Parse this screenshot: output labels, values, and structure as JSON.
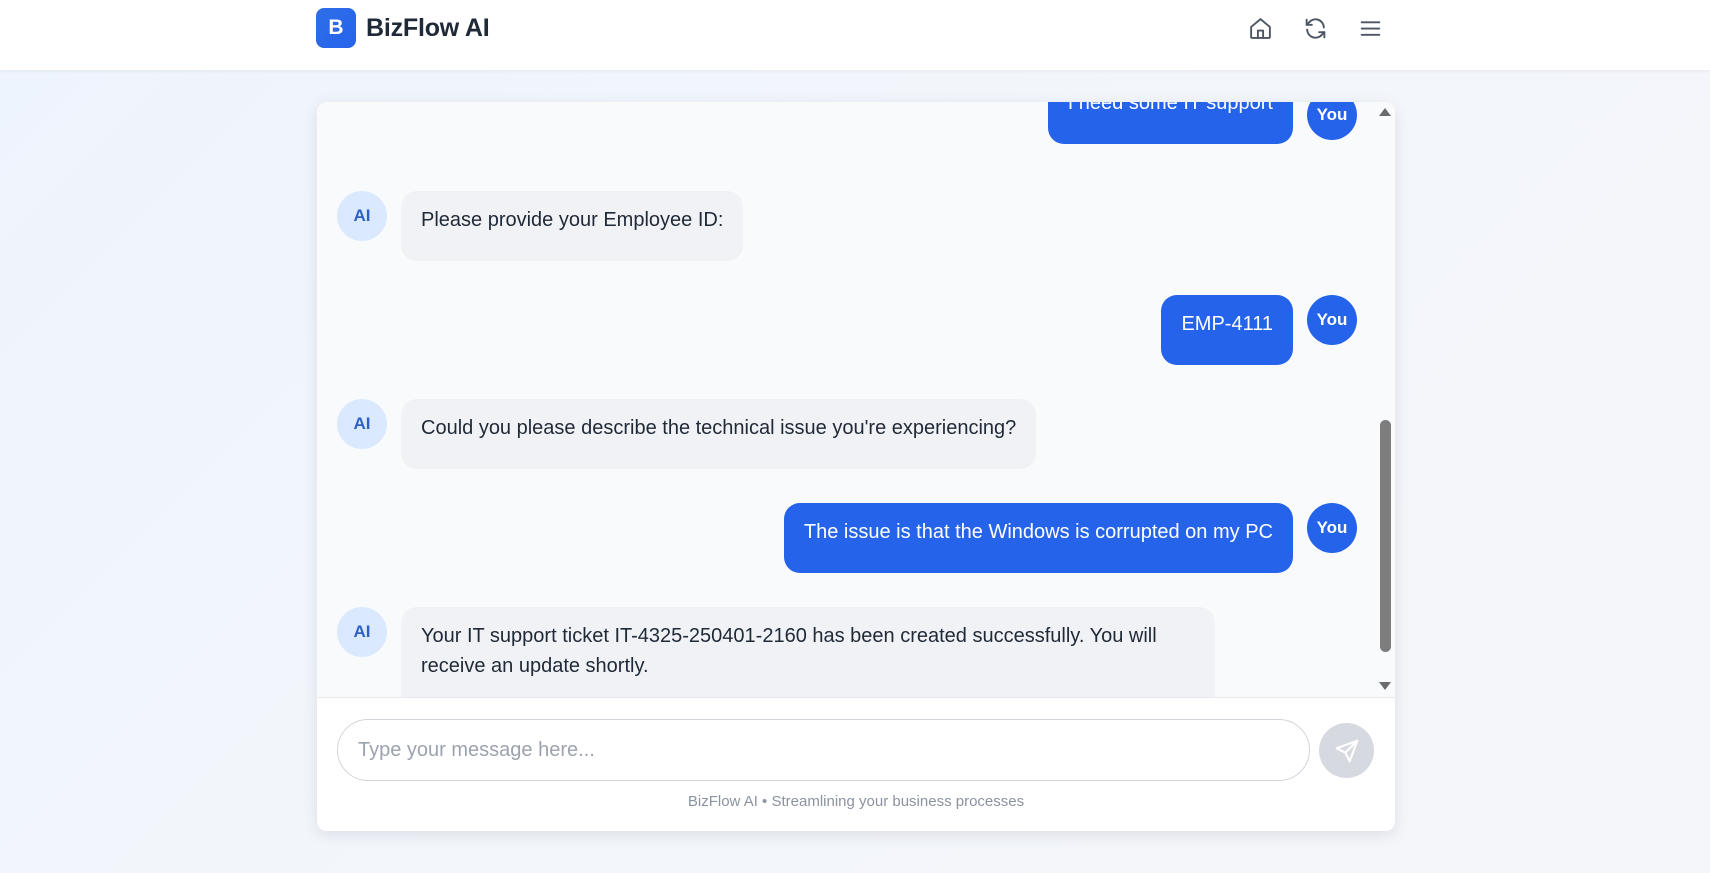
{
  "header": {
    "logo_letter": "B",
    "app_name": "BizFlow AI",
    "icons": [
      "home-icon",
      "refresh-icon",
      "menu-icon"
    ]
  },
  "chat": {
    "messages": [
      {
        "sender": "you",
        "avatar": "You",
        "text": "I need some IT support"
      },
      {
        "sender": "ai",
        "avatar": "AI",
        "text": "Please provide your Employee ID:"
      },
      {
        "sender": "you",
        "avatar": "You",
        "text": "EMP-4111"
      },
      {
        "sender": "ai",
        "avatar": "AI",
        "text": "Could you please describe the technical issue you're experiencing?"
      },
      {
        "sender": "you",
        "avatar": "You",
        "text": "The issue is that the Windows is corrupted on my PC"
      },
      {
        "sender": "ai",
        "avatar": "AI",
        "text": "Your IT support ticket IT-4325-250401-2160 has been created successfully. You will receive an update shortly."
      }
    ]
  },
  "composer": {
    "placeholder": "Type your message here...",
    "value": "",
    "send_icon": "send-icon",
    "footer": "BizFlow AI • Streamlining your business processes"
  },
  "colors": {
    "accent": "#2563eb",
    "ai_bubble": "#f1f2f5",
    "ai_avatar_bg": "#dbe9fe"
  }
}
